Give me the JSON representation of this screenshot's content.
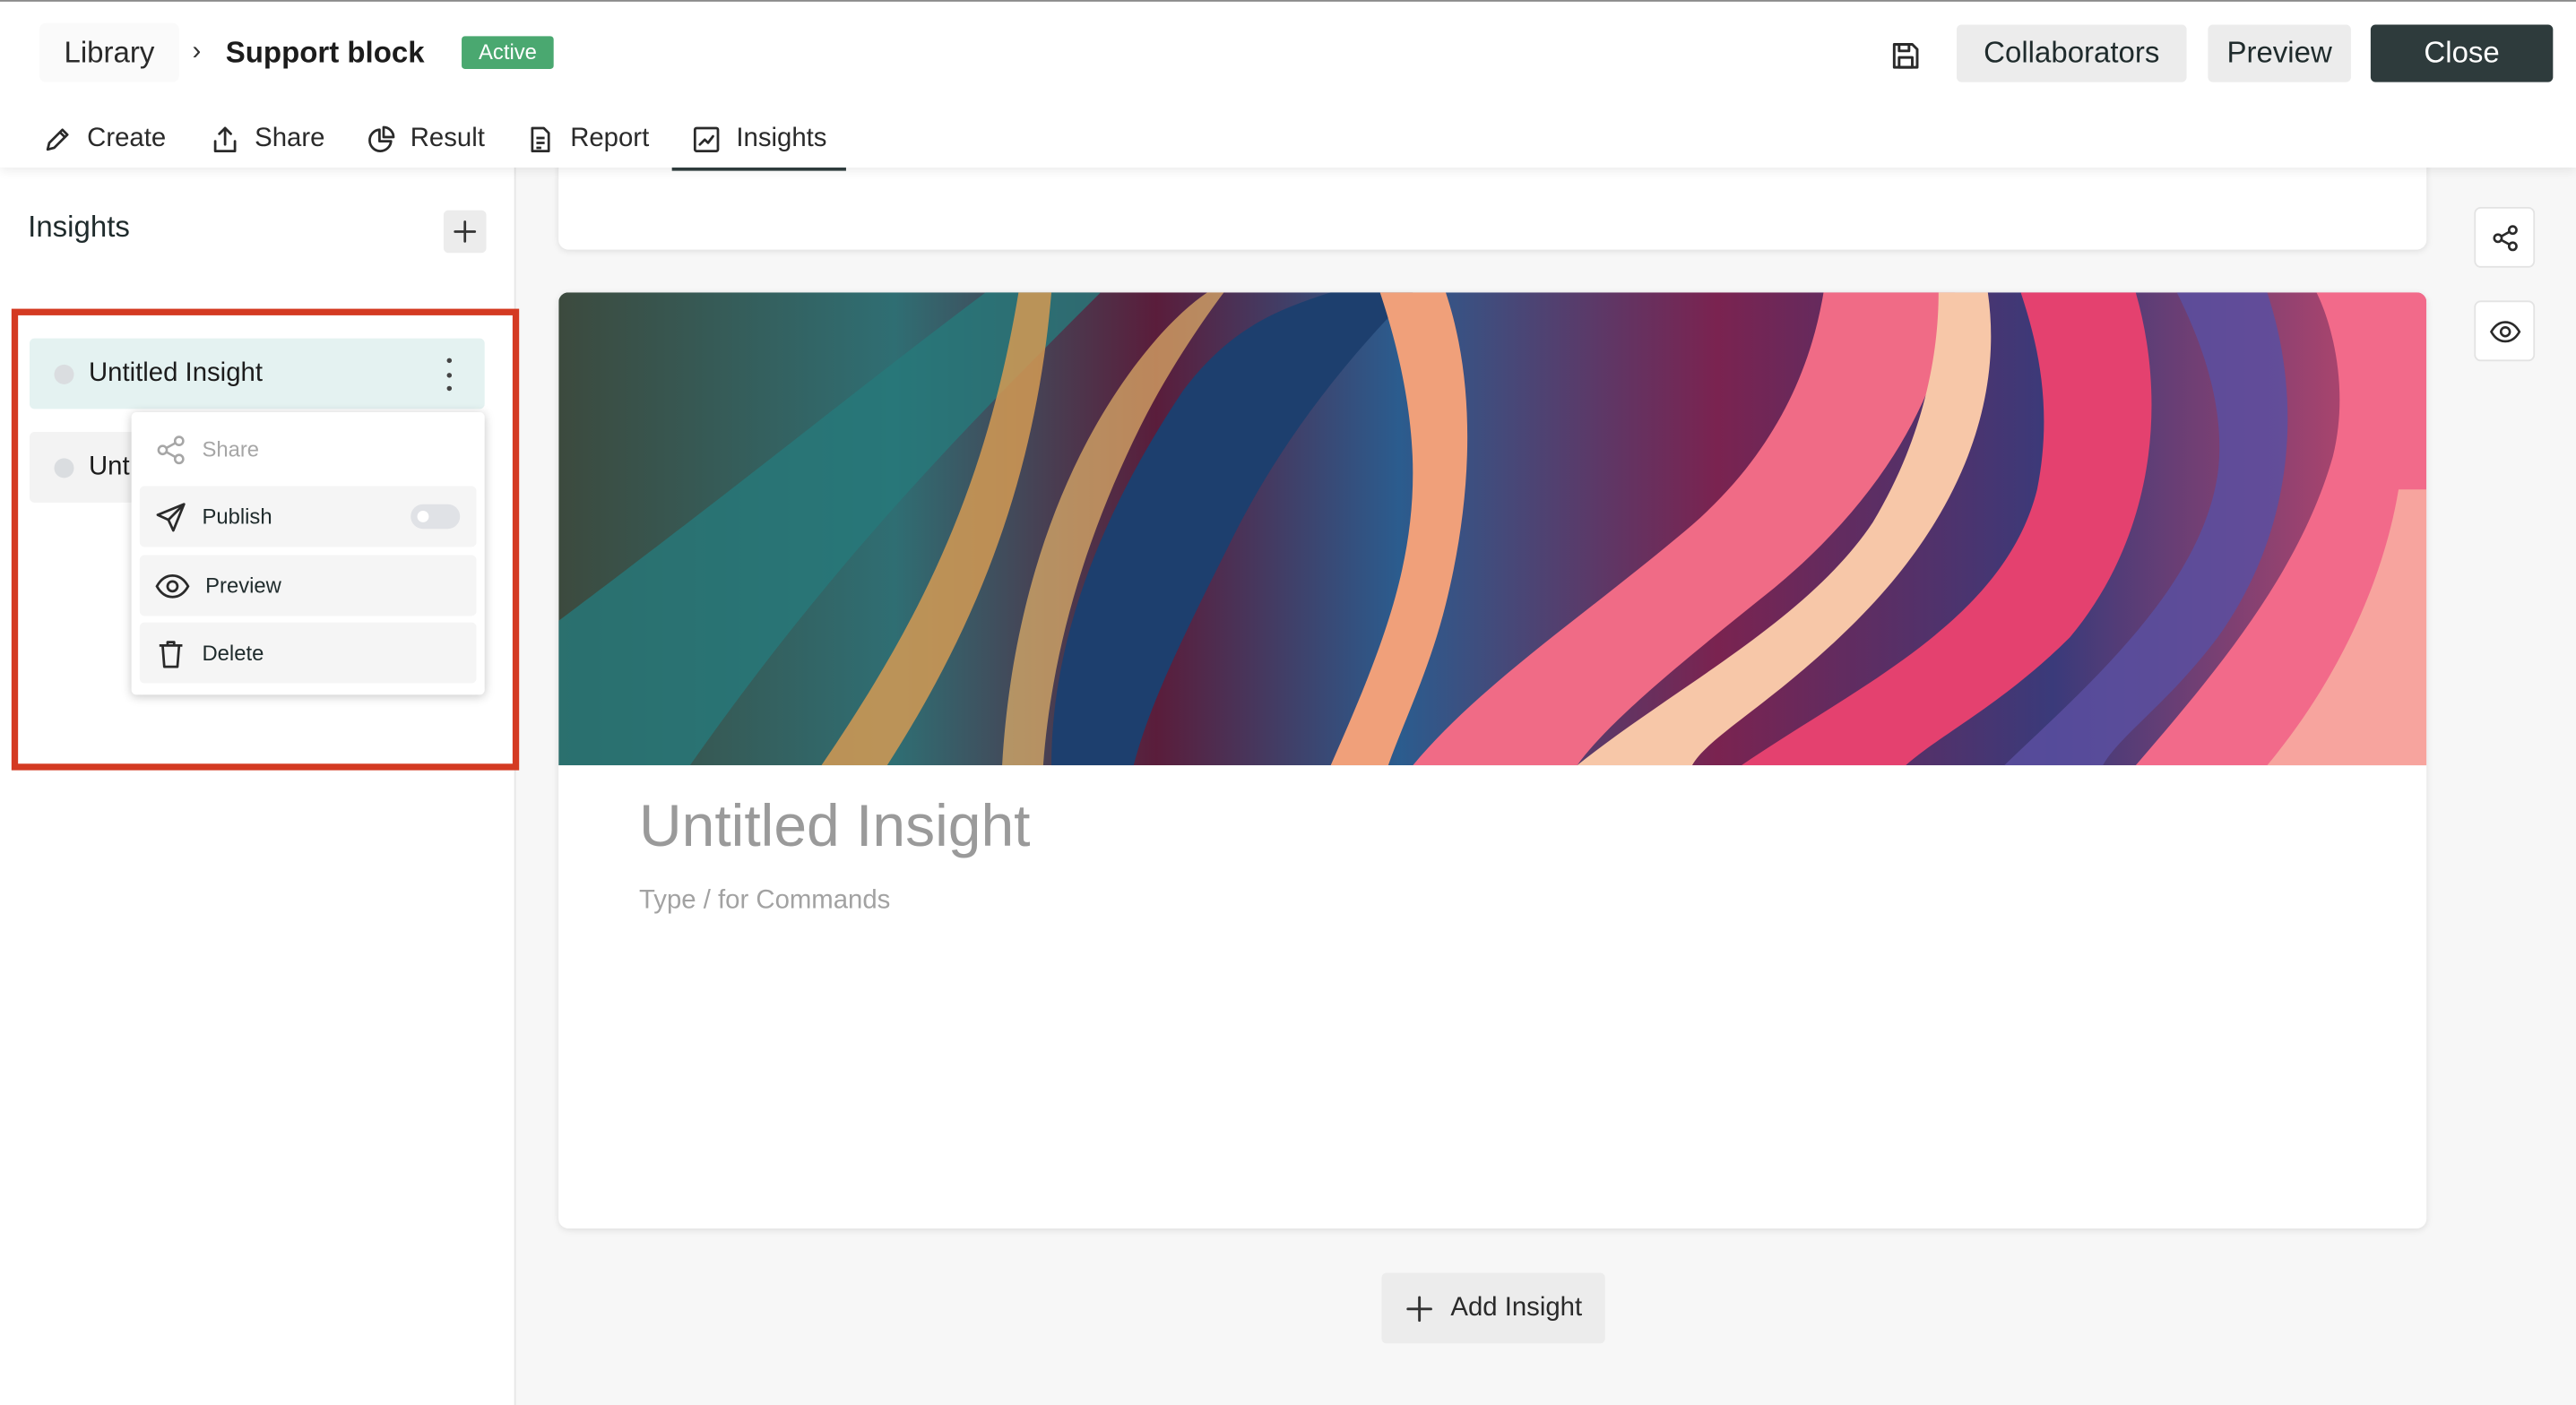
{
  "breadcrumb": {
    "root": "Library",
    "separator": "›",
    "current": "Support block",
    "status": "Active"
  },
  "header": {
    "save_icon": "floppy-disk-icon",
    "collaborators_label": "Collaborators",
    "preview_label": "Preview",
    "close_label": "Close"
  },
  "tabs": [
    {
      "label": "Create",
      "icon": "pencil-icon"
    },
    {
      "label": "Share",
      "icon": "upload-icon"
    },
    {
      "label": "Result",
      "icon": "pie-chart-icon"
    },
    {
      "label": "Report",
      "icon": "document-icon"
    },
    {
      "label": "Insights",
      "icon": "line-chart-icon",
      "active": true
    }
  ],
  "sidebar": {
    "title": "Insights",
    "items": [
      {
        "label": "Untitled Insight"
      },
      {
        "label": "Unt"
      }
    ],
    "menu": {
      "share": "Share",
      "publish": "Publish",
      "publish_enabled": false,
      "preview": "Preview",
      "delete": "Delete"
    }
  },
  "main": {
    "insight_title_placeholder": "Untitled Insight",
    "body_hint": "Type / for Commands",
    "add_insight_label": "Add Insight"
  },
  "colors": {
    "brand_dark": "#2e3b3c",
    "active_badge": "#4aa870",
    "highlight_border": "#d43a22",
    "selected_item_bg": "#e4f2f1"
  }
}
